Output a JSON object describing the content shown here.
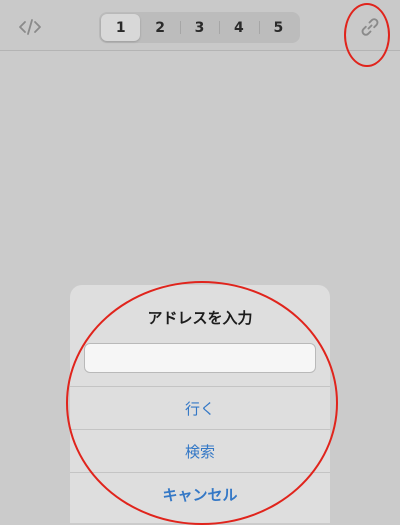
{
  "toolbar": {
    "code_icon": "code-icon",
    "tabs": [
      "1",
      "2",
      "3",
      "4",
      "5"
    ],
    "selected_tab": "1",
    "link_icon": "link-icon"
  },
  "dialog": {
    "title": "アドレスを入力",
    "input_value": "",
    "actions": {
      "go": "行く",
      "search": "検索",
      "cancel": "キャンセル"
    }
  },
  "colors": {
    "accent": "#3478c6",
    "annotation": "#e0241c",
    "background": "#cbcbcb"
  }
}
